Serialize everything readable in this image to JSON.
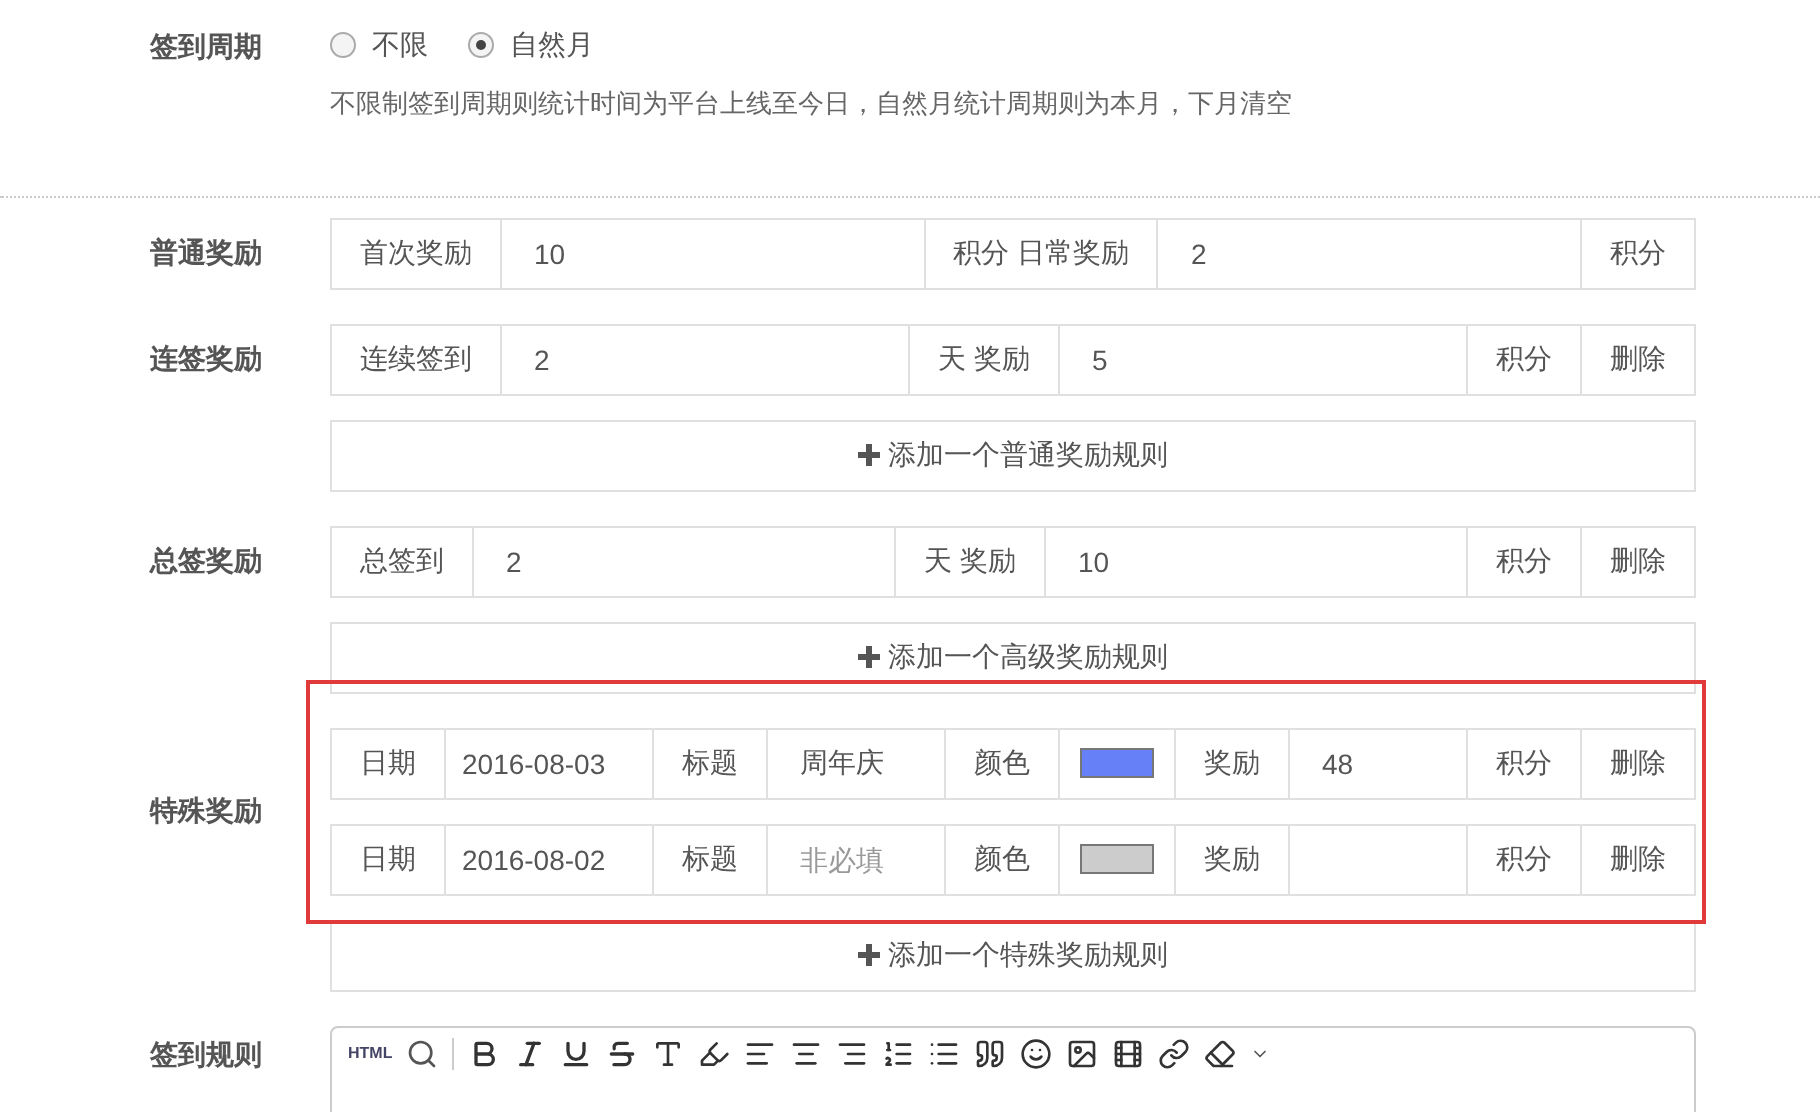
{
  "cycle": {
    "label": "签到周期",
    "options": [
      {
        "label": "不限",
        "selected": false
      },
      {
        "label": "自然月",
        "selected": true
      }
    ],
    "hint": "不限制签到周期则统计时间为平台上线至今日，自然月统计周期则为本月，下月清空"
  },
  "sections": [
    {
      "label": "普通奖励",
      "rows": [
        [
          {
            "kind": "addon",
            "text": "首次奖励"
          },
          {
            "kind": "input",
            "value": "10"
          },
          {
            "kind": "addon",
            "text": "积分 日常奖励"
          },
          {
            "kind": "input",
            "value": "2"
          },
          {
            "kind": "addon",
            "text": "积分"
          }
        ]
      ]
    },
    {
      "label": "连签奖励",
      "rows": [
        [
          {
            "kind": "addon",
            "text": "连续签到"
          },
          {
            "kind": "input",
            "value": "2"
          },
          {
            "kind": "addon",
            "text": "天 奖励"
          },
          {
            "kind": "input",
            "value": "5"
          },
          {
            "kind": "addon",
            "text": "积分"
          },
          {
            "kind": "delete",
            "text": "删除"
          }
        ]
      ],
      "add": "添加一个普通奖励规则"
    },
    {
      "label": "总签奖励",
      "rows": [
        [
          {
            "kind": "addon",
            "text": "总签到"
          },
          {
            "kind": "input",
            "value": "2"
          },
          {
            "kind": "addon",
            "text": "天 奖励"
          },
          {
            "kind": "input",
            "value": "10"
          },
          {
            "kind": "addon",
            "text": "积分"
          },
          {
            "kind": "delete",
            "text": "删除"
          }
        ]
      ],
      "add": "添加一个高级奖励规则"
    },
    {
      "label": "特殊奖励",
      "highlighted": true,
      "rows": [
        [
          {
            "kind": "addon",
            "text": "日期"
          },
          {
            "kind": "date",
            "value": "2016-08-03"
          },
          {
            "kind": "addon",
            "text": "标题"
          },
          {
            "kind": "input",
            "value": "周年庆"
          },
          {
            "kind": "addon",
            "text": "颜色"
          },
          {
            "kind": "color",
            "color": "#6680f8"
          },
          {
            "kind": "addon",
            "text": "奖励"
          },
          {
            "kind": "input",
            "value": "48"
          },
          {
            "kind": "addon",
            "text": "积分"
          },
          {
            "kind": "delete",
            "text": "删除"
          }
        ],
        [
          {
            "kind": "addon",
            "text": "日期"
          },
          {
            "kind": "date",
            "value": "2016-08-02"
          },
          {
            "kind": "addon",
            "text": "标题"
          },
          {
            "kind": "input",
            "placeholder": "非必填"
          },
          {
            "kind": "addon",
            "text": "颜色"
          },
          {
            "kind": "color",
            "color": "#cccccc"
          },
          {
            "kind": "addon",
            "text": "奖励"
          },
          {
            "kind": "input"
          },
          {
            "kind": "addon",
            "text": "积分"
          },
          {
            "kind": "delete",
            "text": "删除"
          }
        ]
      ],
      "add": "添加一个特殊奖励规则"
    }
  ],
  "rules": {
    "label": "签到规则",
    "html_button": "HTML"
  }
}
